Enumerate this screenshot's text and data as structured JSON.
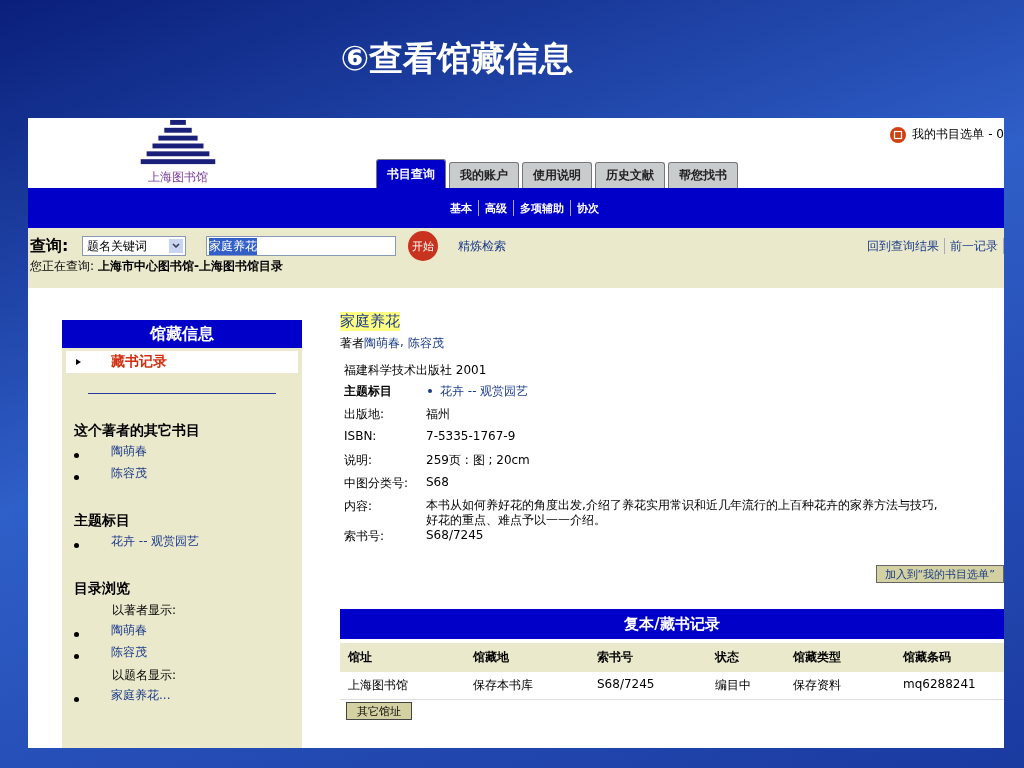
{
  "slide_title": "⑥查看馆藏信息",
  "header": {
    "logo_text": "上海图书馆",
    "cart_text": "我的书目选单 - 0",
    "tabs": [
      {
        "label": "书目查询",
        "selected": true
      },
      {
        "label": "我的账户",
        "selected": false
      },
      {
        "label": "使用说明",
        "selected": false
      },
      {
        "label": "历史文献",
        "selected": false
      },
      {
        "label": "帮您找书",
        "selected": false
      }
    ],
    "subnav": [
      "基本",
      "高级",
      "多项辅助",
      "协次"
    ]
  },
  "search": {
    "label": "查询:",
    "field_select": "题名关键词",
    "query": "家庭养花",
    "go_label": "开始",
    "refine": "精炼检索",
    "nav_links": [
      "回到查询结果",
      "前一记录"
    ],
    "scope_prefix": "您正在查询:",
    "scope_value": "上海市中心图书馆-上海图书馆目录"
  },
  "sidebar": {
    "title": "馆藏信息",
    "items": [
      {
        "label": "藏书记录",
        "selected": true
      }
    ],
    "sections": [
      {
        "heading": "这个著者的其它书目",
        "groups": [
          {
            "links": [
              "陶萌春",
              "陈容茂"
            ]
          }
        ]
      },
      {
        "heading": "主题标目",
        "groups": [
          {
            "links": [
              "花卉 -- 观赏园艺"
            ]
          }
        ]
      },
      {
        "heading": "目录浏览",
        "groups": [
          {
            "label": "以著者显示:",
            "links": [
              "陶萌春",
              "陈容茂"
            ]
          },
          {
            "label": "以题名显示:",
            "links": [
              "家庭养花..."
            ]
          }
        ]
      }
    ]
  },
  "record": {
    "title": "家庭养花",
    "authors_label": "著者",
    "authors_separator": ",",
    "authors": [
      "陶萌春",
      "陈容茂"
    ],
    "publisher": "福建科学技术出版社  2001",
    "fields": [
      {
        "label": "主题标目",
        "kind": "link",
        "value": "花卉 -- 观赏园艺"
      },
      {
        "label": "出版地:",
        "kind": "text",
        "value": "福州"
      },
      {
        "label": "ISBN:",
        "kind": "text",
        "value": "7-5335-1767-9"
      },
      {
        "label": "说明:",
        "kind": "text",
        "value": "259页 : 图 ; 20cm"
      },
      {
        "label": "中图分类号:",
        "kind": "text",
        "value": "S68"
      },
      {
        "label": "内容:",
        "kind": "paragraph",
        "lines": [
          "本书从如何养好花的角度出发,介绍了养花实用常识和近几年流行的上百种花卉的家养方法与技巧,",
          "好花的重点、难点予以一一介绍。"
        ]
      },
      {
        "label": "索书号:",
        "kind": "text",
        "value": "S68/7245"
      }
    ],
    "add_button": "加入到“我的书目选单”"
  },
  "holdings": {
    "title": "复本/藏书记录",
    "columns": [
      "馆址",
      "馆藏地",
      "索书号",
      "状态",
      "馆藏类型",
      "馆藏条码"
    ],
    "rows": [
      [
        "上海图书馆",
        "保存本书库",
        "S68/7245",
        "编目中",
        "保存资料",
        "mq6288241"
      ]
    ],
    "other_button": "其它馆址"
  }
}
